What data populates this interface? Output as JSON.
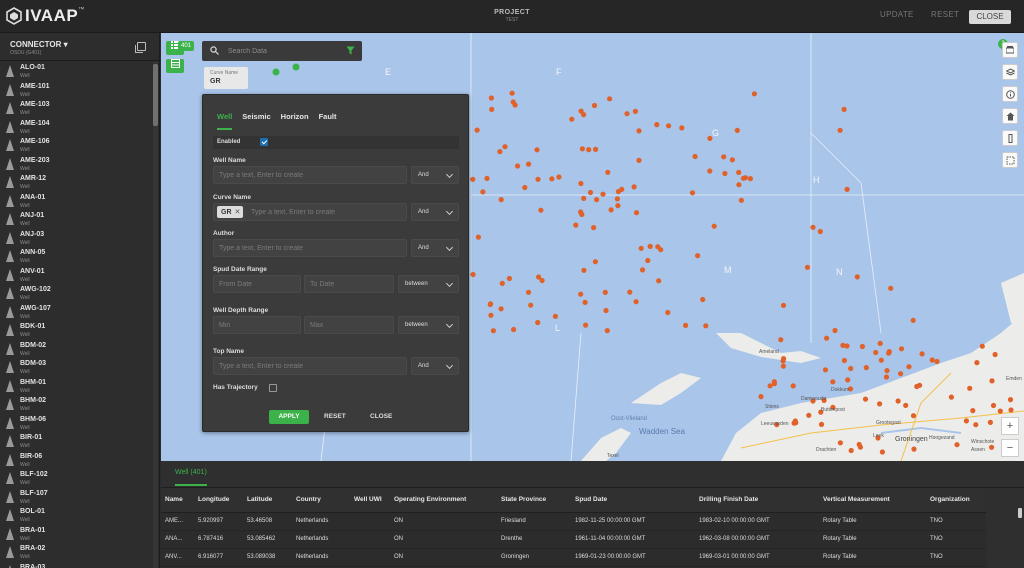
{
  "header": {
    "logo": "IVAAP",
    "logo_tm": "™",
    "project_title": "PROJECT",
    "project_sub": "TEST",
    "update_label": "UPDATE",
    "reset_label": "RESET",
    "close_label": "CLOSE"
  },
  "sidebar": {
    "title": "CONNECTOR",
    "subtitle": "OSDU (G401)",
    "items": [
      {
        "name": "ALO-01",
        "type": "Well"
      },
      {
        "name": "AME-101",
        "type": "Well"
      },
      {
        "name": "AME-103",
        "type": "Well"
      },
      {
        "name": "AME-104",
        "type": "Well"
      },
      {
        "name": "AME-106",
        "type": "Well"
      },
      {
        "name": "AME-203",
        "type": "Well"
      },
      {
        "name": "AMR-12",
        "type": "Well"
      },
      {
        "name": "ANA-01",
        "type": "Well"
      },
      {
        "name": "ANJ-01",
        "type": "Well"
      },
      {
        "name": "ANJ-03",
        "type": "Well"
      },
      {
        "name": "ANN-05",
        "type": "Well"
      },
      {
        "name": "ANV-01",
        "type": "Well"
      },
      {
        "name": "AWG-102",
        "type": "Well"
      },
      {
        "name": "AWG-107",
        "type": "Well"
      },
      {
        "name": "BDK-01",
        "type": "Well"
      },
      {
        "name": "BDM-02",
        "type": "Well"
      },
      {
        "name": "BDM-03",
        "type": "Well"
      },
      {
        "name": "BHM-01",
        "type": "Well"
      },
      {
        "name": "BHM-02",
        "type": "Well"
      },
      {
        "name": "BHM-06",
        "type": "Well"
      },
      {
        "name": "BIR-01",
        "type": "Well"
      },
      {
        "name": "BIR-06",
        "type": "Well"
      },
      {
        "name": "BLF-102",
        "type": "Well"
      },
      {
        "name": "BLF-107",
        "type": "Well"
      },
      {
        "name": "BOL-01",
        "type": "Well"
      },
      {
        "name": "BRA-01",
        "type": "Well"
      },
      {
        "name": "BRA-02",
        "type": "Well"
      },
      {
        "name": "BRA-03",
        "type": "Well"
      }
    ]
  },
  "toolbar": {
    "count_badge": "401",
    "search_placeholder": "Search Data",
    "curve_chip_label": "Curve Name",
    "curve_chip_value": "GR"
  },
  "map": {
    "grid_labels": {
      "E": "E",
      "F": "F",
      "G": "G",
      "H": "H",
      "L": "L",
      "M": "M",
      "N": "N"
    },
    "badge": "3",
    "place_labels": [
      "Oost-Vlieland",
      "Wadden Sea",
      "Leeuwarden",
      "Groningen",
      "Drachten",
      "Dokkum",
      "Assen",
      "Emden",
      "Texel",
      "Stiens",
      "Buttenpost",
      "Grootegast",
      "Leek",
      "Hoogezand",
      "Damwoude",
      "Winschote",
      "Ameland"
    ],
    "zoom_in": "+",
    "zoom_out": "−"
  },
  "filter": {
    "tabs": [
      "Well",
      "Seismic",
      "Horizon",
      "Fault"
    ],
    "enabled_label": "Enabled",
    "well_name_label": "Well Name",
    "well_name_placeholder": "Type a text, Enter to create",
    "curve_name_label": "Curve Name",
    "curve_tag": "GR",
    "curve_placeholder": "Type a text, Enter to create",
    "author_label": "Author",
    "author_placeholder": "Type a text, Enter to create",
    "spud_label": "Spud Date Range",
    "from_placeholder": "From Date",
    "to_placeholder": "To Date",
    "depth_label": "Well Depth Range",
    "min_placeholder": "Min",
    "max_placeholder": "Max",
    "top_label": "Top Name",
    "top_placeholder": "Type a text, Enter to create",
    "traj_label": "Has Trajectory",
    "and": "And",
    "between": "between",
    "apply": "APPLY",
    "reset": "RESET",
    "close": "CLOSE"
  },
  "table": {
    "tab_label": "Well (401)",
    "columns": [
      "Name",
      "Longitude",
      "Latitude",
      "Country",
      "Well UWI",
      "Operating Environment",
      "State Province",
      "Spud Date",
      "Drilling Finish Date",
      "Vertical Measurement",
      "Organization"
    ],
    "rows": [
      [
        "AME...",
        "5.920997",
        "53.46508",
        "Netherlands",
        "",
        "ON",
        "Friesland",
        "1982-11-25 00:00:00 GMT",
        "1983-02-10 00:00:00 GMT",
        "Rotary Table",
        "TNO"
      ],
      [
        "ANA...",
        "6.787416",
        "53.085462",
        "Netherlands",
        "",
        "ON",
        "Drenthe",
        "1961-11-04 00:00:00 GMT",
        "1962-03-08 00:00:00 GMT",
        "Rotary Table",
        "TNO"
      ],
      [
        "ANV...",
        "6.916077",
        "53.089038",
        "Netherlands",
        "",
        "ON",
        "Groningen",
        "1969-01-23 00:00:00 GMT",
        "1969-03-01 00:00:00 GMT",
        "Rotary Table",
        "TNO"
      ]
    ]
  },
  "colors": {
    "accent": "#3cb34a",
    "well_dot": "#e0622a",
    "sea": "#a9c5ea",
    "land": "#ececea"
  }
}
